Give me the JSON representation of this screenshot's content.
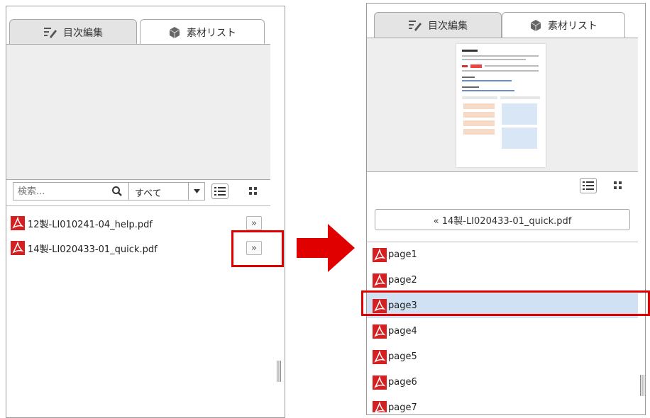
{
  "colors": {
    "accent_red": "#e00000",
    "selected_row": "#cfe1f2",
    "pdf_red": "#d42020"
  },
  "left": {
    "tabs": [
      {
        "label": "目次編集",
        "icon": "toc-edit-icon",
        "active": false
      },
      {
        "label": "素材リスト",
        "icon": "cube-icon",
        "active": true
      }
    ],
    "search": {
      "placeholder": "検索...",
      "icon": "search-icon"
    },
    "filter": {
      "value": "すべて",
      "icon": "chevron-down-icon"
    },
    "files": [
      {
        "name": "12製-LI010241-04_help.pdf",
        "button": "»"
      },
      {
        "name": "14製-LI020433-01_quick.pdf",
        "button": "»"
      }
    ]
  },
  "right": {
    "tabs": [
      {
        "label": "目次編集",
        "icon": "toc-edit-icon",
        "active": false
      },
      {
        "label": "素材リスト",
        "icon": "cube-icon",
        "active": true
      }
    ],
    "back_button": "« 14製-LI020433-01_quick.pdf",
    "pages": [
      "page1",
      "page2",
      "page3",
      "page4",
      "page5",
      "page6",
      "page7"
    ],
    "selected_page": "page3"
  }
}
